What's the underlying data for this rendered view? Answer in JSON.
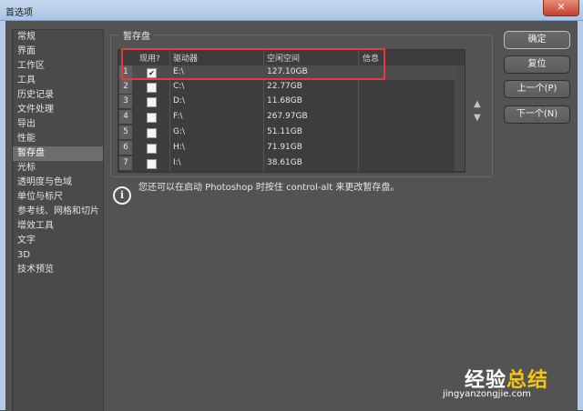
{
  "window": {
    "title": "首选项",
    "close_glyph": "✕"
  },
  "sidebar": {
    "items": [
      {
        "label": "常规"
      },
      {
        "label": "界面"
      },
      {
        "label": "工作区"
      },
      {
        "label": "工具"
      },
      {
        "label": "历史记录"
      },
      {
        "label": "文件处理"
      },
      {
        "label": "导出"
      },
      {
        "label": "性能"
      },
      {
        "label": "暂存盘",
        "active": true
      },
      {
        "label": "光标"
      },
      {
        "label": "透明度与色域"
      },
      {
        "label": "单位与标尺"
      },
      {
        "label": "参考线、网格和切片"
      },
      {
        "label": "增效工具"
      },
      {
        "label": "文字"
      },
      {
        "label": "3D"
      },
      {
        "label": "技术预览"
      }
    ]
  },
  "scratch": {
    "group_title": "暂存盘",
    "headers": {
      "active": "现用?",
      "drive": "驱动器",
      "free_space": "空闲空间",
      "info": "信息"
    },
    "rows": [
      {
        "num": "1",
        "checked": true,
        "drive": "E:\\",
        "space": "127.10GB",
        "info": ""
      },
      {
        "num": "2",
        "checked": false,
        "drive": "C:\\",
        "space": "22.77GB",
        "info": ""
      },
      {
        "num": "3",
        "checked": false,
        "drive": "D:\\",
        "space": "11.68GB",
        "info": ""
      },
      {
        "num": "4",
        "checked": false,
        "drive": "F:\\",
        "space": "267.97GB",
        "info": ""
      },
      {
        "num": "5",
        "checked": false,
        "drive": "G:\\",
        "space": "51.11GB",
        "info": ""
      },
      {
        "num": "6",
        "checked": false,
        "drive": "H:\\",
        "space": "71.91GB",
        "info": ""
      },
      {
        "num": "7",
        "checked": false,
        "drive": "I:\\",
        "space": "38.61GB",
        "info": ""
      }
    ],
    "move_up_glyph": "▲",
    "move_down_glyph": "▼",
    "note": "您还可以在启动 Photoshop 时按住 control-alt 来更改暂存盘。",
    "info_glyph": "i"
  },
  "buttons": {
    "ok": "确定",
    "reset": "复位",
    "prev": "上一个(P)",
    "next": "下一个(N)"
  },
  "watermark": {
    "main_a": "经验",
    "main_b": "总结",
    "sub": "jingyanzongjie.com"
  },
  "colors": {
    "highlight": "#e03c3c",
    "watermark_accent": "#f0c419"
  }
}
